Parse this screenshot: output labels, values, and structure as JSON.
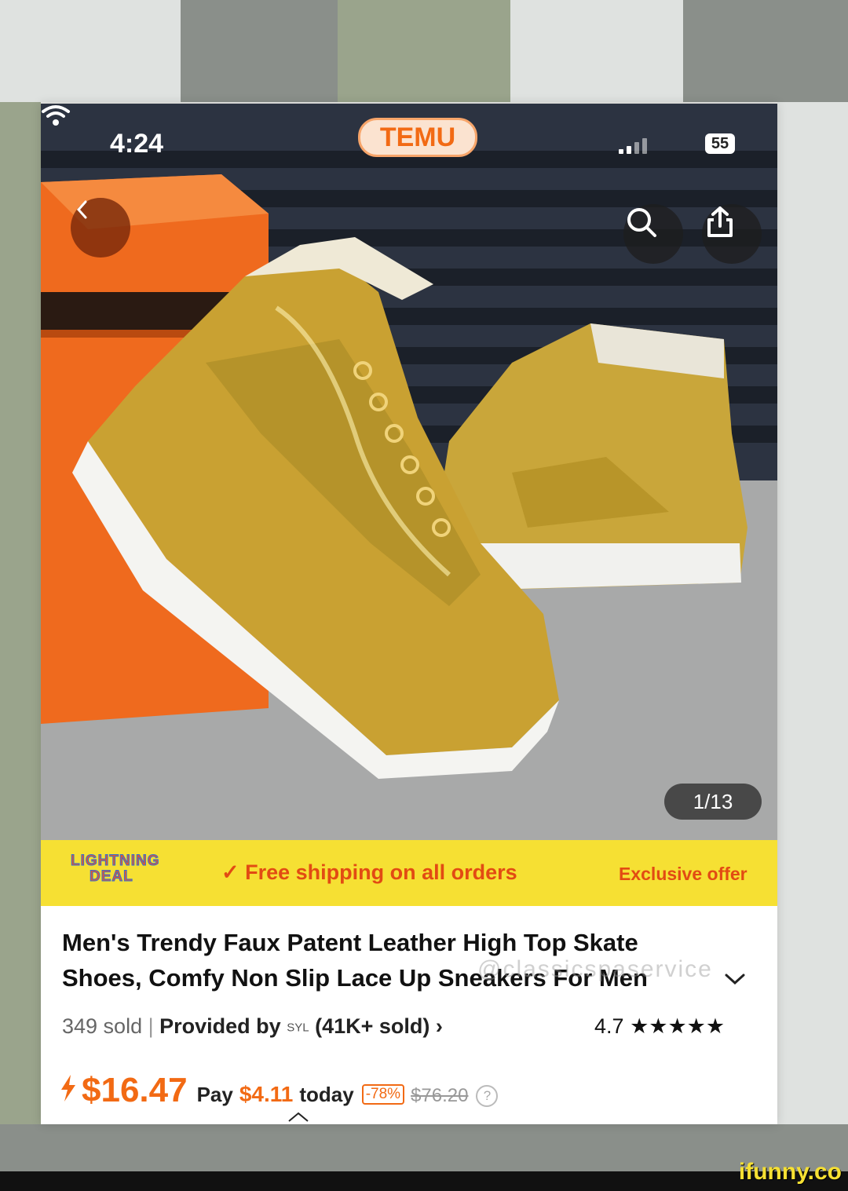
{
  "status_bar": {
    "time": "4:24",
    "battery": "55",
    "icons": [
      "cellular-signal-icon",
      "wifi-icon",
      "battery-icon"
    ]
  },
  "app": {
    "logo_text": "TEMU",
    "colors": {
      "brand_orange": "#f26a14",
      "promo_yellow": "#f6e033"
    }
  },
  "gallery": {
    "counter": "1/13",
    "current_image": 1,
    "total_images": 13
  },
  "nav": {
    "icons": [
      "back-chevron-icon",
      "search-icon",
      "share-icon"
    ]
  },
  "promo": {
    "badge_line1": "LIGHTNING",
    "badge_line2": "DEAL",
    "free_shipping": "✓ Free shipping on all orders",
    "exclusive": "Exclusive offer"
  },
  "product": {
    "title": "Men's Trendy Faux Patent Leather High Top Skate Shoes, Comfy Non Slip Lace Up Sneakers For Men",
    "sold": "349 sold",
    "separator": "|",
    "provided_by": "Provided by",
    "seller_logo": "SYL",
    "seller_sold": "(41K+ sold)",
    "seller_chevron": "›",
    "rating": "4.7",
    "stars": "★★★★★",
    "price": "$16.47",
    "pay_label": "Pay",
    "pay_amount": "$4.11",
    "today_label": "today",
    "discount": "-78%",
    "original_price": "$76.20",
    "help": "?"
  },
  "watermark": "@classicspaservice",
  "site_watermark": "ifunny.co"
}
